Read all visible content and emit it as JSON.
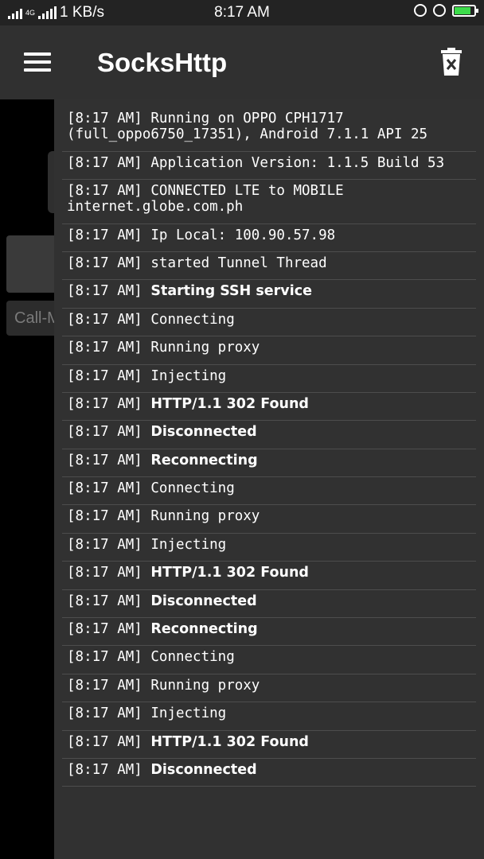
{
  "status_bar": {
    "network_speed": "1 KB/s",
    "network_type": "4G",
    "time": "8:17 AM",
    "battery_color": "#3ddc4b"
  },
  "app_bar": {
    "title": "SocksHttp",
    "menu_icon": "menu-icon",
    "clear_icon": "trash-icon"
  },
  "background": {
    "input_placeholder": "Call-M"
  },
  "logs": [
    {
      "time": "[8:17 AM]",
      "message": "Running on OPPO CPH1717 (full_oppo6750_17351), Android 7.1.1 API 25",
      "bold": false
    },
    {
      "time": "[8:17 AM]",
      "message": "Application Version: 1.1.5 Build 53",
      "bold": false
    },
    {
      "time": "[8:17 AM]",
      "message": "CONNECTED LTE to MOBILE internet.globe.com.ph",
      "bold": false
    },
    {
      "time": "[8:17 AM]",
      "message": "Ip Local: 100.90.57.98",
      "bold": false
    },
    {
      "time": "[8:17 AM]",
      "message": "started Tunnel Thread",
      "bold": false
    },
    {
      "time": "[8:17 AM]",
      "message": "Starting SSH service",
      "bold": true
    },
    {
      "time": "[8:17 AM]",
      "message": "Connecting",
      "bold": false
    },
    {
      "time": "[8:17 AM]",
      "message": "Running proxy",
      "bold": false
    },
    {
      "time": "[8:17 AM]",
      "message": "Injecting",
      "bold": false
    },
    {
      "time": "[8:17 AM]",
      "message": "HTTP/1.1 302 Found",
      "bold": true
    },
    {
      "time": "[8:17 AM]",
      "message": "Disconnected",
      "bold": true
    },
    {
      "time": "[8:17 AM]",
      "message": "Reconnecting",
      "bold": true
    },
    {
      "time": "[8:17 AM]",
      "message": "Connecting",
      "bold": false
    },
    {
      "time": "[8:17 AM]",
      "message": "Running proxy",
      "bold": false
    },
    {
      "time": "[8:17 AM]",
      "message": "Injecting",
      "bold": false
    },
    {
      "time": "[8:17 AM]",
      "message": "HTTP/1.1 302 Found",
      "bold": true
    },
    {
      "time": "[8:17 AM]",
      "message": "Disconnected",
      "bold": true
    },
    {
      "time": "[8:17 AM]",
      "message": "Reconnecting",
      "bold": true
    },
    {
      "time": "[8:17 AM]",
      "message": "Connecting",
      "bold": false
    },
    {
      "time": "[8:17 AM]",
      "message": "Running proxy",
      "bold": false
    },
    {
      "time": "[8:17 AM]",
      "message": "Injecting",
      "bold": false
    },
    {
      "time": "[8:17 AM]",
      "message": "HTTP/1.1 302 Found",
      "bold": true
    },
    {
      "time": "[8:17 AM]",
      "message": "Disconnected",
      "bold": true
    }
  ]
}
